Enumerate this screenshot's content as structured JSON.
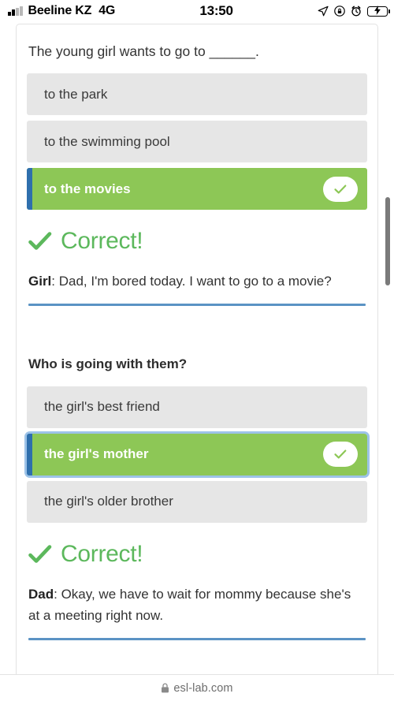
{
  "status_bar": {
    "carrier": "Beeline KZ",
    "network": "4G",
    "time": "13:50",
    "icons": [
      "signal-bars-icon",
      "location-arrow-icon",
      "rotation-lock-icon",
      "alarm-clock-icon",
      "battery-charging-icon"
    ]
  },
  "quiz": {
    "blocks": [
      {
        "question": "The young girl wants to go to ______.",
        "question_bold": false,
        "options": [
          {
            "label": "to the park",
            "selected": false,
            "focused": false
          },
          {
            "label": "to the swimming pool",
            "selected": false,
            "focused": false
          },
          {
            "label": "to the movies",
            "selected": true,
            "focused": false
          }
        ],
        "verdict": "Correct!",
        "dialogue_speaker": "Girl",
        "dialogue_text": ": Dad, I'm bored today. I want to go to a movie?"
      },
      {
        "question": "Who is going with them?",
        "question_bold": true,
        "options": [
          {
            "label": "the girl's best friend",
            "selected": false,
            "focused": false
          },
          {
            "label": "the girl's mother",
            "selected": true,
            "focused": true
          },
          {
            "label": "the girl's older brother",
            "selected": false,
            "focused": false
          }
        ],
        "verdict": "Correct!",
        "dialogue_speaker": "Dad",
        "dialogue_text": ": Okay, we have to wait for mommy because she's at a meeting right now."
      }
    ]
  },
  "footer": {
    "url": "esl-lab.com",
    "lock_icon": "lock-icon"
  },
  "colors": {
    "correct_green": "#5cb85c",
    "option_green": "#8dc756",
    "accent_blue": "#2f6fad",
    "divider_blue": "#5b93c4",
    "option_gray": "#e6e6e6",
    "battery_green": "#4cd764"
  }
}
